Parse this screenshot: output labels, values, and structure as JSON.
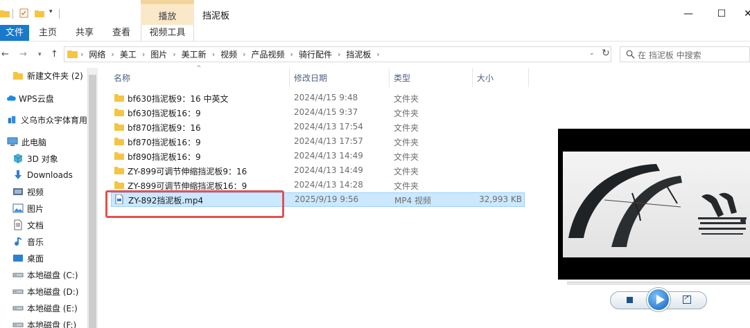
{
  "window": {
    "title": "挡泥板",
    "context_tab_header": "播放",
    "controls": {
      "min": "—",
      "max": "☐",
      "close": "✕"
    }
  },
  "ribbon": {
    "file": "文件",
    "home": "主页",
    "share": "共享",
    "view": "查看",
    "video_tools": "视频工具"
  },
  "address": {
    "crumbs": [
      "网络",
      "美工",
      "图片",
      "美工新",
      "视频",
      "产品视频",
      "骑行配件",
      "挡泥板"
    ]
  },
  "search": {
    "placeholder": "在 挡泥板 中搜索"
  },
  "sidebar": {
    "items": [
      {
        "label": "新建文件夹 (2)",
        "icon": "folder-icon"
      },
      {
        "label": "WPS云盘",
        "icon": "cloud-icon"
      },
      {
        "label": "义乌市众宇体育用",
        "icon": "company-icon"
      },
      {
        "label": "此电脑",
        "icon": "pc-icon"
      },
      {
        "label": "3D 对象",
        "icon": "3d-objects-icon"
      },
      {
        "label": "Downloads",
        "icon": "download-icon"
      },
      {
        "label": "视频",
        "icon": "video-icon"
      },
      {
        "label": "图片",
        "icon": "pictures-icon"
      },
      {
        "label": "文档",
        "icon": "documents-icon"
      },
      {
        "label": "音乐",
        "icon": "music-icon"
      },
      {
        "label": "桌面",
        "icon": "desktop-icon"
      },
      {
        "label": "本地磁盘 (C:)",
        "icon": "drive-icon"
      },
      {
        "label": "本地磁盘 (D:)",
        "icon": "drive-icon"
      },
      {
        "label": "本地磁盘 (E:)",
        "icon": "drive-icon"
      },
      {
        "label": "本地磁盘 (F:)",
        "icon": "drive-icon"
      }
    ]
  },
  "columns": {
    "name": "名称",
    "date": "修改日期",
    "type": "类型",
    "size": "大小"
  },
  "files": [
    {
      "name": "bf630挡泥板9：16 中英文",
      "date": "2024/4/15 9:48",
      "type": "文件夹",
      "size": ""
    },
    {
      "name": "bf630挡泥板16：9",
      "date": "2024/4/15 9:37",
      "type": "文件夹",
      "size": ""
    },
    {
      "name": "bf870挡泥板9：16",
      "date": "2024/4/13 17:54",
      "type": "文件夹",
      "size": ""
    },
    {
      "name": "bf870挡泥板16：9",
      "date": "2024/4/13 17:57",
      "type": "文件夹",
      "size": ""
    },
    {
      "name": "bf890挡泥板16：9",
      "date": "2024/4/13 14:49",
      "type": "文件夹",
      "size": ""
    },
    {
      "name": "ZY-899可调节伸缩挡泥板9：16",
      "date": "2024/4/13 14:49",
      "type": "文件夹",
      "size": ""
    },
    {
      "name": "ZY-899可调节伸缩挡泥板16：9",
      "date": "2024/4/13 14:28",
      "type": "文件夹",
      "size": ""
    },
    {
      "name": "ZY-892挡泥板.mp4",
      "date": "2025/9/19 9:56",
      "type": "MP4 视频",
      "size": "32,993 KB"
    }
  ],
  "colors": {
    "accent": "#1979ca",
    "selection": "#cce8ff",
    "highlight_box": "#e05252",
    "folder": "#f5c542"
  }
}
